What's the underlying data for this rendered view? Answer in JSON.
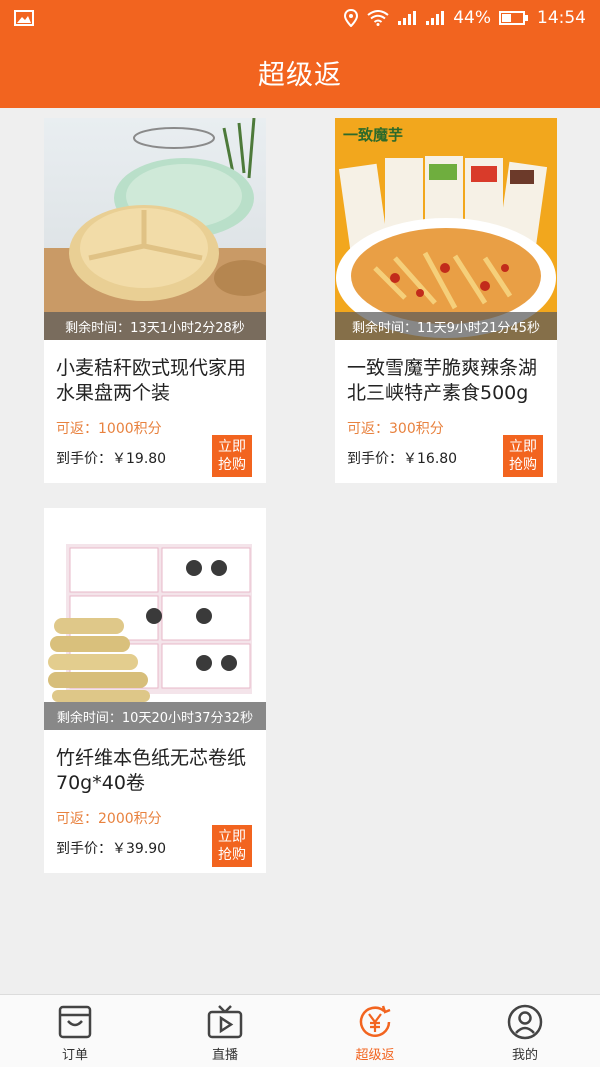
{
  "status_bar": {
    "battery_percent": "44%",
    "time": "14:54"
  },
  "header": {
    "title": "超级返"
  },
  "products": [
    {
      "timer": "剩余时间：13天1小时2分28秒",
      "title": "小麦秸秆欧式现代家用水果盘两个装",
      "rebate": "可返：1000积分",
      "price": "到手价：￥19.80",
      "buy_label": "立即\n抢购"
    },
    {
      "timer": "剩余时间：11天9小时21分45秒",
      "title": "一致雪魔芋脆爽辣条湖北三峡特产素食500g",
      "rebate": "可返：300积分",
      "price": "到手价：￥16.80",
      "buy_label": "立即\n抢购",
      "image_brand": "一致魔芋"
    },
    {
      "timer": "剩余时间：10天20小时37分32秒",
      "title": "竹纤维本色纸无芯卷纸70g*40卷",
      "rebate": "可返：2000积分",
      "price": "到手价：￥39.90",
      "buy_label": "立即\n抢购"
    }
  ],
  "tab_bar": {
    "items": [
      {
        "label": "订单",
        "icon": "order-bag-icon"
      },
      {
        "label": "直播",
        "icon": "tv-play-icon"
      },
      {
        "label": "超级返",
        "icon": "yen-refund-icon",
        "active": true
      },
      {
        "label": "我的",
        "icon": "user-icon"
      }
    ]
  },
  "colors": {
    "accent": "#f2641f",
    "rebate_text": "#e8823f",
    "background": "#efefef"
  }
}
